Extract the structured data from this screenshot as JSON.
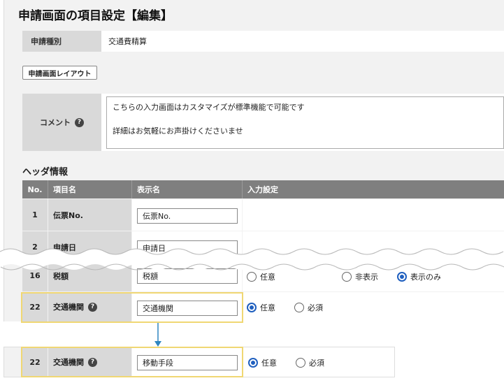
{
  "title": "申請画面の項目設定【編集】",
  "application_type": {
    "label": "申請種別",
    "value": "交通費精算"
  },
  "layout_button": "申請画面レイアウト",
  "comment": {
    "label": "コメント",
    "lines": [
      "こちらの入力画面はカスタマイズが標準機能で可能です",
      "詳細はお気軽にお声掛けくださいませ"
    ]
  },
  "header_section": "ヘッダ情報",
  "columns": {
    "no": "No.",
    "item": "項目名",
    "display": "表示名",
    "input": "入力設定"
  },
  "rows": [
    {
      "no": "1",
      "item": "伝票No.",
      "display": "伝票No."
    },
    {
      "no": "2",
      "item": "申請日",
      "display": "申請日"
    },
    {
      "no": "16",
      "item": "税額",
      "display": "税額",
      "options": [
        "任意",
        "非表示",
        "表示のみ"
      ],
      "selected": "表示のみ"
    },
    {
      "no": "22",
      "item": "交通機関",
      "display": "交通機関",
      "options": [
        "任意",
        "必須"
      ],
      "selected": "任意"
    }
  ],
  "after": {
    "no": "22",
    "item": "交通機関",
    "display": "移動手段",
    "options": [
      "任意",
      "必須"
    ],
    "selected": "任意"
  },
  "icons": {
    "help": "question-circle-icon",
    "arrow": "arrow-down-icon"
  },
  "colors": {
    "highlight": "#f0d773",
    "accent": "#1f5fbf",
    "arrow": "#2e86c1",
    "header": "#7f7f7f"
  }
}
